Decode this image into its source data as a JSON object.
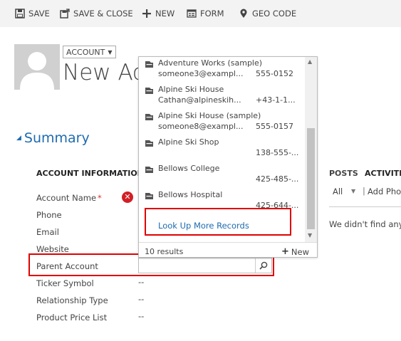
{
  "command_bar": {
    "items": [
      {
        "label": "SAVE",
        "icon": "save-icon"
      },
      {
        "label": "SAVE & CLOSE",
        "icon": "save-close-icon"
      },
      {
        "label": "NEW",
        "icon": "plus-icon"
      },
      {
        "label": "FORM",
        "icon": "form-icon"
      },
      {
        "label": "GEO CODE",
        "icon": "map-pin-icon"
      }
    ]
  },
  "header": {
    "entity_type": "ACCOUNT",
    "title": "New Ac"
  },
  "summary": {
    "label": "Summary"
  },
  "section": {
    "heading": "ACCOUNT INFORMATION",
    "fields": [
      {
        "label": "Account Name",
        "required": "*",
        "value": ""
      },
      {
        "label": "Phone",
        "value": ""
      },
      {
        "label": "Email",
        "value": ""
      },
      {
        "label": "Website",
        "value": ""
      },
      {
        "label": "Parent Account",
        "value": ""
      },
      {
        "label": "Ticker Symbol",
        "value": "--"
      },
      {
        "label": "Relationship Type",
        "value": "--"
      },
      {
        "label": "Product Price List",
        "value": "--"
      }
    ]
  },
  "right_panel": {
    "tabs": [
      "POSTS",
      "ACTIVITI"
    ],
    "filter": "All",
    "separator": "|",
    "add_phone": "Add Pho",
    "empty_text": "We didn't find any a"
  },
  "lookup": {
    "results": [
      {
        "name": "Adventure Works (sample)",
        "email": "someone3@exampl...",
        "phone": "555-0152"
      },
      {
        "name": "Alpine Ski House",
        "email": "Cathan@alpineskih...",
        "phone": "+43-1-1..."
      },
      {
        "name": "Alpine Ski House (sample)",
        "email": "someone8@exampl...",
        "phone": "555-0157"
      },
      {
        "name": "Alpine Ski Shop",
        "email": "",
        "phone": "138-555-..."
      },
      {
        "name": "Bellows College",
        "email": "",
        "phone": "425-485-..."
      },
      {
        "name": "Bellows Hospital",
        "email": "",
        "phone": "425-644-..."
      }
    ],
    "lookup_more": "Look Up More Records",
    "results_count": "10 results",
    "new_label": "New"
  },
  "colors": {
    "accent": "#1e6bb0",
    "highlight": "#e00000",
    "error": "#d21f26",
    "command_bar_bg": "#f3f3f3"
  }
}
